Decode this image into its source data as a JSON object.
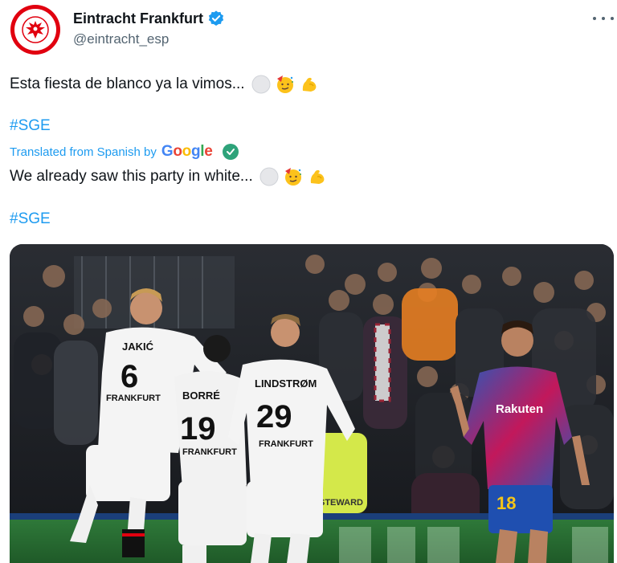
{
  "author": {
    "display_name": "Eintracht Frankfurt",
    "handle": "@eintracht_esp",
    "verified": true
  },
  "tweet": {
    "original_text": "Esta fiesta de blanco ya la vimos...",
    "hashtag": "#SGE",
    "translation_label": "Translated from Spanish by",
    "translation_provider": "Google",
    "translated_text": "We already saw this party in white...",
    "translated_hashtag": "#SGE",
    "emojis": [
      "white-circle-emoji",
      "partying-face-emoji",
      "flexed-biceps-emoji"
    ]
  },
  "photo": {
    "players": [
      {
        "name": "JAKIĆ",
        "number": "6",
        "club": "FRANKFURT"
      },
      {
        "name": "BORRÉ",
        "number": "19",
        "club": "FRANKFURT"
      },
      {
        "name": "LINDSTRØM",
        "number": "29",
        "club": "FRANKFURT"
      }
    ],
    "opponent": {
      "sponsor": "Rakuten",
      "number": "18"
    },
    "steward_vest": "STEWARD"
  },
  "colors": {
    "link": "#1d9bf0",
    "muted": "#536471",
    "club_red": "#e1000f",
    "barca_blue": "#2c57b8",
    "barca_pink": "#c2185b"
  }
}
